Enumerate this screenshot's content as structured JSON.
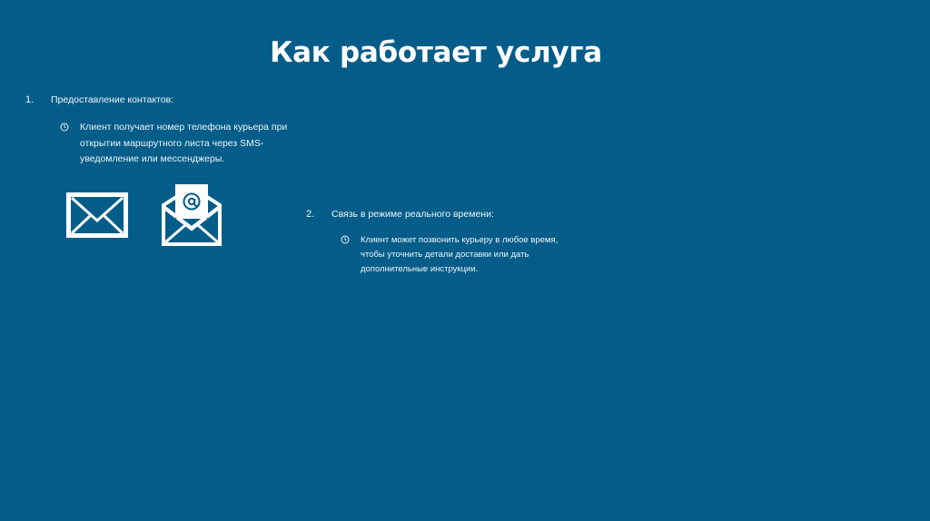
{
  "slide": {
    "title": "Как работает услуга",
    "background": "#045d89",
    "items": [
      {
        "number": "1.",
        "heading": "Предоставление контактов:",
        "bullet_icon": "clock-icon",
        "bullet_lines": [
          "Клиент получает номер телефона курьера при",
          "открытии маршрутного листа  через SMS-",
          "уведомление или мессенджеры."
        ]
      },
      {
        "number": "2.",
        "heading": "Связь в режиме реального времени:",
        "bullet_icon": "clock-icon",
        "bullet_lines": [
          "Клиент может позвонить курьеру в любое время,",
          "чтобы уточнить детали доставки или дать",
          "дополнительные инструкции."
        ]
      }
    ],
    "icons": [
      "envelope-icon",
      "email-at-icon"
    ]
  }
}
